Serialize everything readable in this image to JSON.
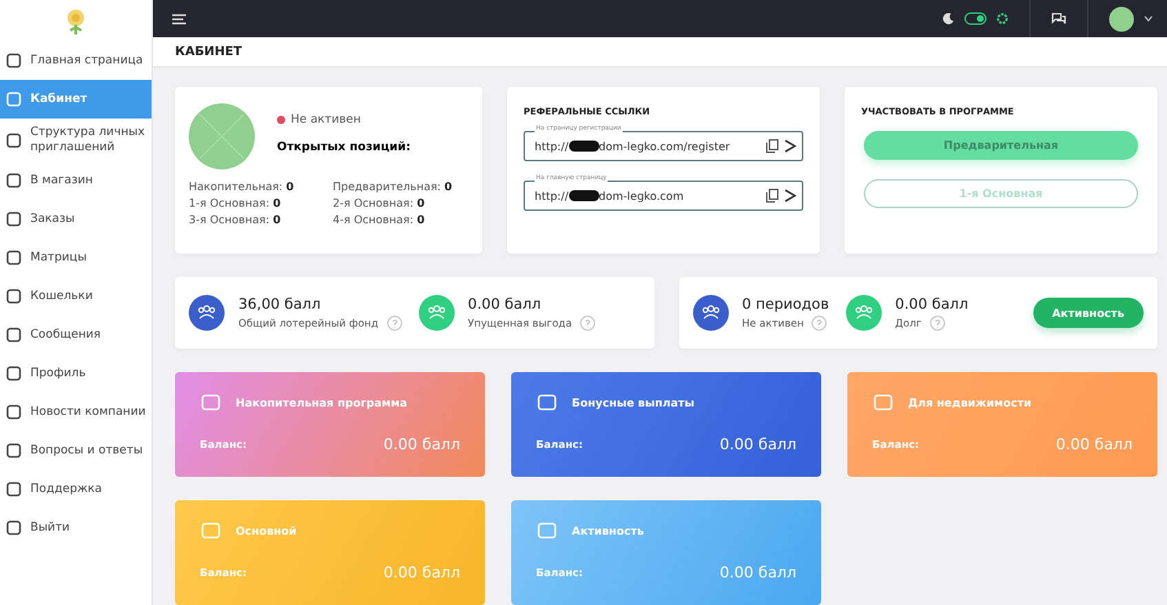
{
  "sidebar": {
    "items": [
      {
        "label": "Главная страница",
        "selected": false
      },
      {
        "label": "Кабинет",
        "selected": true
      },
      {
        "label": "Структура личных приглашений",
        "selected": false
      },
      {
        "label": "В магазин",
        "selected": false
      },
      {
        "label": "Заказы",
        "selected": false
      },
      {
        "label": "Матрицы",
        "selected": false
      },
      {
        "label": "Кошельки",
        "selected": false
      },
      {
        "label": "Сообщения",
        "selected": false
      },
      {
        "label": "Профиль",
        "selected": false
      },
      {
        "label": "Новости компании",
        "selected": false
      },
      {
        "label": "Вопросы и ответы",
        "selected": false
      },
      {
        "label": "Поддержка",
        "selected": false
      },
      {
        "label": "Выйти",
        "selected": false
      }
    ]
  },
  "topbar": {
    "theme_switch": {
      "on": true
    }
  },
  "page_title": "КАБИНЕТ",
  "profile": {
    "status": "Не активен",
    "active": false,
    "positions_title": "Открытых позиций:",
    "positions": [
      {
        "label": "Накопительная:",
        "value": "0"
      },
      {
        "label": "Предварительная:",
        "value": "0"
      },
      {
        "label": "1-я Основная:",
        "value": "0"
      },
      {
        "label": "2-я Основная:",
        "value": "0"
      },
      {
        "label": "3-я Основная:",
        "value": "0"
      },
      {
        "label": "4-я Основная:",
        "value": "0"
      }
    ]
  },
  "referral": {
    "title": "РЕФЕРАЛЬНЫЕ ССЫЛКИ",
    "links": [
      {
        "label": "На страницу регистрации",
        "prefix": "http://",
        "rest": "dom-legko.com/register"
      },
      {
        "label": "На главную страницу",
        "prefix": "http://",
        "rest": "dom-legko.com"
      }
    ]
  },
  "program": {
    "title": "УЧАСТВОВАТЬ В ПРОГРАММЕ",
    "buttons": [
      {
        "label": "Предварительная",
        "selected": true
      },
      {
        "label": "1-я Основная",
        "selected": false
      }
    ]
  },
  "stats": [
    [
      {
        "value": "36,00 балл",
        "label": "Общий лотерейный фонд",
        "color": "#3a5fcd"
      },
      {
        "value": "0.00 балл",
        "label": "Упущенная выгода",
        "color": "#2fd07f"
      }
    ],
    [
      {
        "value": "0 периодов",
        "label": "Не активен",
        "color": "#3a5fcd"
      },
      {
        "value": "0.00 балл",
        "label": "Долг",
        "color": "#2fd07f"
      }
    ]
  ],
  "activity_button": "Активность",
  "balances": [
    {
      "title": "Накопительная программа",
      "balance_label": "Баланс:",
      "amount": "0.00 балл",
      "color": "#e08ee8"
    },
    {
      "title": "Бонусные выплаты",
      "balance_label": "Баланс:",
      "amount": "0.00 балл",
      "color": "#4c7be8"
    },
    {
      "title": "Для недвижимости",
      "balance_label": "Баланс:",
      "amount": "0.00 балл",
      "color": "#ffa766"
    },
    {
      "title": "Основной",
      "balance_label": "Баланс:",
      "amount": "0.00 балл",
      "color": "#ffc94a"
    },
    {
      "title": "Активность",
      "balance_label": "Баланс:",
      "amount": "0.00 балл",
      "color": "#7ec4f8"
    }
  ]
}
